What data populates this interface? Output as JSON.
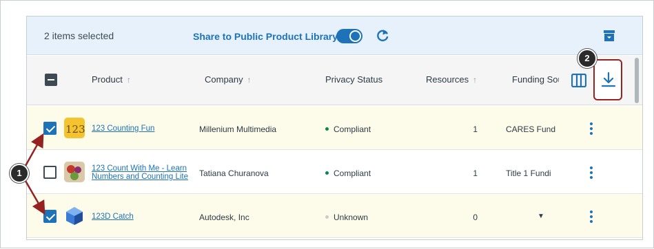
{
  "selection_bar": {
    "count_text": "2 items selected",
    "share_label": "Share to Public Product Library",
    "toggle_on": true
  },
  "columns": [
    {
      "label": "Product",
      "sort": "↑"
    },
    {
      "label": "Company",
      "sort": "↑"
    },
    {
      "label": "Privacy Status",
      "sort": ""
    },
    {
      "label": "Resources",
      "sort": "↑"
    },
    {
      "label": "Funding Sou",
      "sort": ""
    }
  ],
  "rows": [
    {
      "checked": true,
      "name_line1": "123 Counting Fun",
      "name_line2": "",
      "company": "Millenium Multimedia",
      "status": "Compliant",
      "status_color": "#0b874b",
      "resources": "1",
      "funding": "CARES Fundi",
      "has_caret": false
    },
    {
      "checked": false,
      "name_line1": "123 Count With Me - Learn",
      "name_line2": "Numbers and Counting Lite",
      "company": "Tatiana Churanova",
      "status": "Compliant",
      "status_color": "#0b874b",
      "resources": "1",
      "funding": "Title 1 Fundi",
      "has_caret": false
    },
    {
      "checked": true,
      "name_line1": "123D Catch",
      "name_line2": "",
      "company": "Autodesk, Inc",
      "status": "Unknown",
      "status_color": "#c7cdd1",
      "resources": "0",
      "funding": "",
      "has_caret": true
    }
  ],
  "callouts": [
    "1",
    "2"
  ],
  "colors": {
    "accent": "#1d72b8",
    "highlight_border": "#962121",
    "selected_row": "#fdfbe9"
  }
}
